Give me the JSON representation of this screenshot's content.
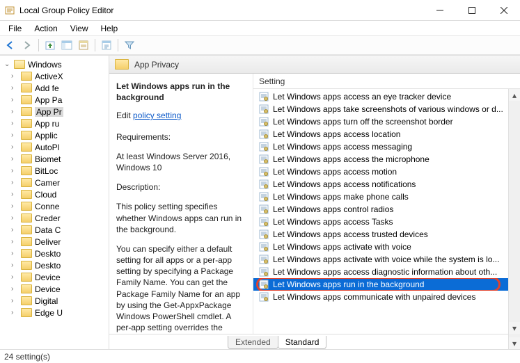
{
  "window": {
    "title": "Local Group Policy Editor"
  },
  "menu": [
    "File",
    "Action",
    "View",
    "Help"
  ],
  "tree": {
    "root": "Windows",
    "items": [
      "ActiveX",
      "Add fe",
      "App Pa",
      "App Pr",
      "App ru",
      "Applic",
      "AutoPl",
      "Biomet",
      "BitLoc",
      "Camer",
      "Cloud",
      "Conne",
      "Creder",
      "Data C",
      "Deliver",
      "Deskto",
      "Deskto",
      "Device",
      "Device",
      "Digital",
      "Edge U"
    ],
    "selected_index": 3
  },
  "detail": {
    "header": "App Privacy",
    "policy_title": "Let Windows apps run in the background",
    "edit_prefix": "Edit",
    "edit_link": "policy setting",
    "req_head": "Requirements:",
    "req_body": "At least Windows Server 2016, Windows 10",
    "desc_head": "Description:",
    "desc_body1": "This policy setting specifies whether Windows apps can run in the background.",
    "desc_body2": "You can specify either a default setting for all apps or a per-app setting by specifying a Package Family Name. You can get the Package Family Name for an app by using the Get-AppxPackage Windows PowerShell cmdlet. A per-app setting overrides the default setting."
  },
  "settings": {
    "column": "Setting",
    "items": [
      "Let Windows apps access an eye tracker device",
      "Let Windows apps take screenshots of various windows or d...",
      "Let Windows apps turn off the screenshot border",
      "Let Windows apps access location",
      "Let Windows apps access messaging",
      "Let Windows apps access the microphone",
      "Let Windows apps access motion",
      "Let Windows apps access notifications",
      "Let Windows apps make phone calls",
      "Let Windows apps control radios",
      "Let Windows apps access Tasks",
      "Let Windows apps access trusted devices",
      "Let Windows apps activate with voice",
      "Let Windows apps activate with voice while the system is lo...",
      "Let Windows apps access diagnostic information about oth...",
      "Let Windows apps run in the background",
      "Let Windows apps communicate with unpaired devices"
    ],
    "selected_index": 15
  },
  "tabs": {
    "extended": "Extended",
    "standard": "Standard"
  },
  "status": "24 setting(s)"
}
